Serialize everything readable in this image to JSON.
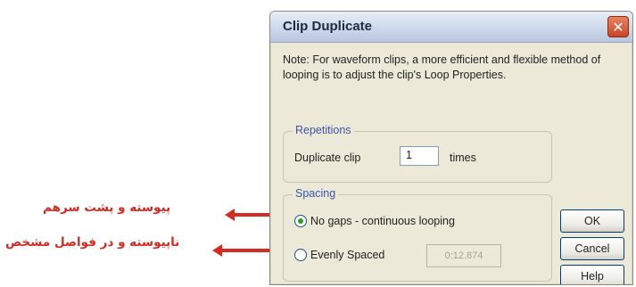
{
  "dialog": {
    "title": "Clip Duplicate",
    "close_glyph": "✕",
    "note": "Note:  For waveform clips, a more efficient and flexible method of looping is to adjust the clip's Loop Properties.",
    "repetitions": {
      "title": "Repetitions",
      "label": "Duplicate clip",
      "value": "1",
      "unit": "times"
    },
    "spacing": {
      "title": "Spacing",
      "options": [
        {
          "label": "No gaps - continuous looping",
          "checked": true
        },
        {
          "label": "Evenly Spaced",
          "checked": false
        }
      ],
      "spaced_value": "0:12.874"
    },
    "buttons": {
      "ok": "OK",
      "cancel": "Cancel",
      "help": "Help"
    }
  },
  "annotations": {
    "first": "پیوسته و پشت سرهم",
    "second": "ناپیوسته و در فواصل مشخص"
  },
  "colors": {
    "annotation": "#d32c22",
    "dialog_bg": "#ece9d8",
    "group_title": "#3a55a8"
  }
}
